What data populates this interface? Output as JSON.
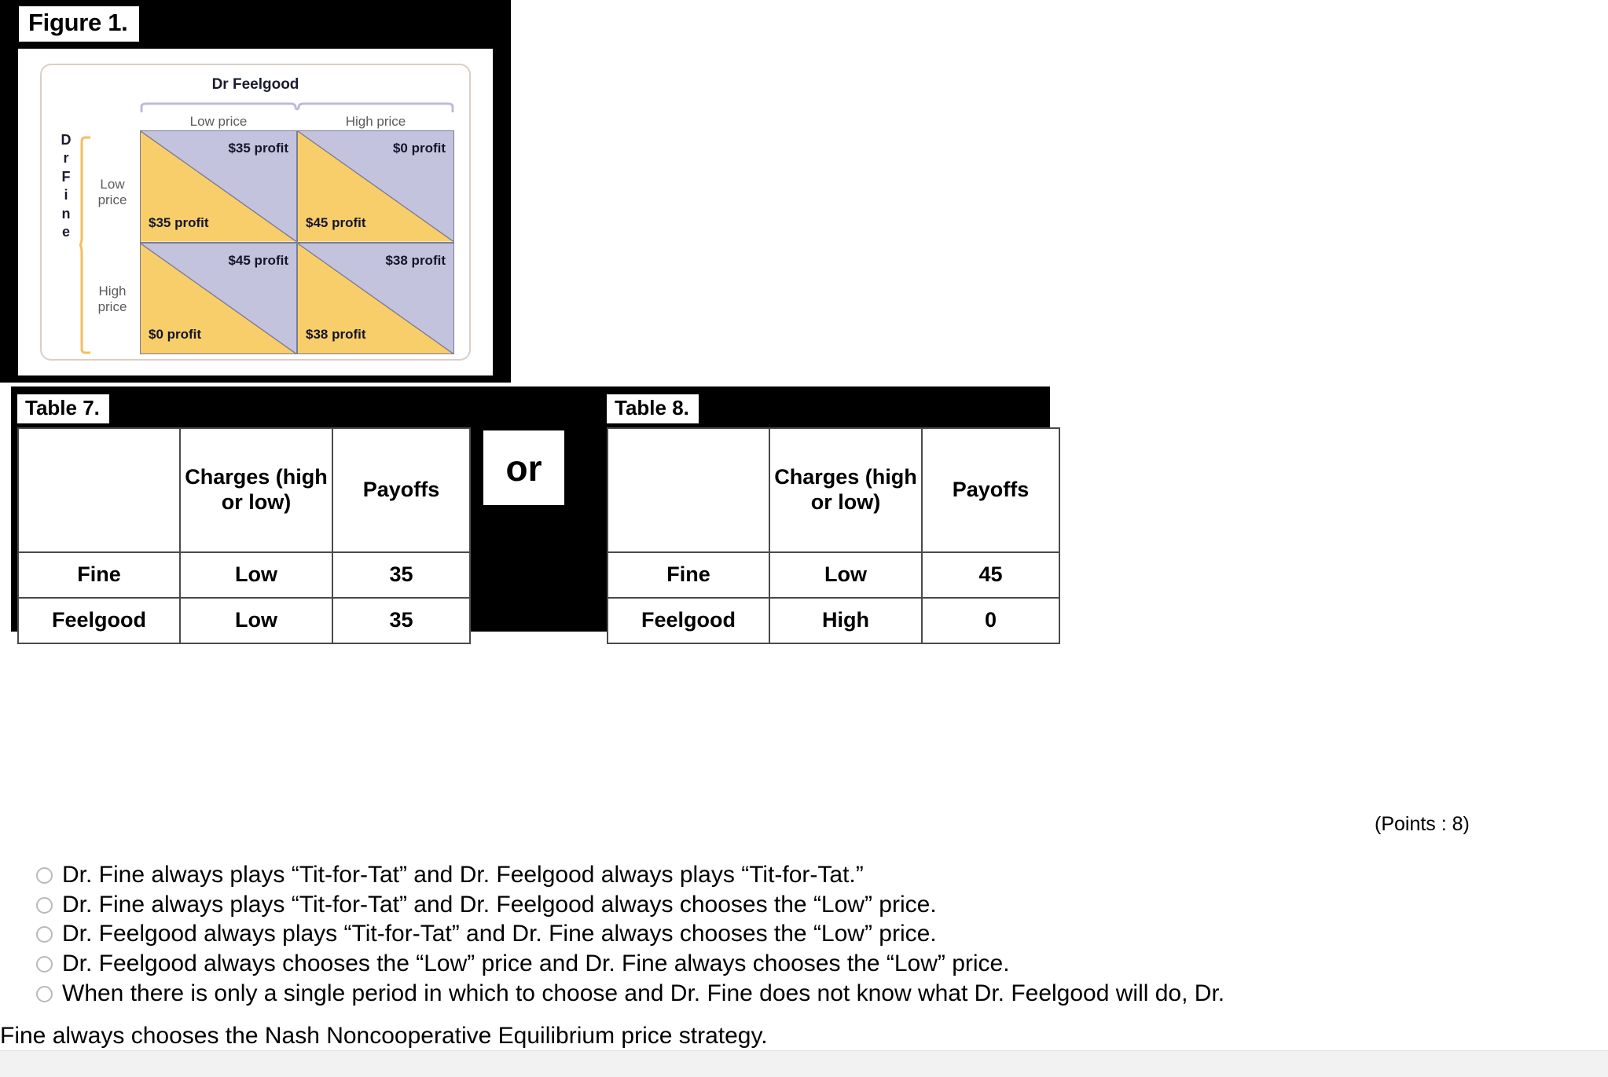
{
  "figure": {
    "title": "Figure 1.",
    "column_player": "Dr Feelgood",
    "column_labels": [
      "Low price",
      "High price"
    ],
    "row_player_letters": [
      "D",
      "r",
      "F",
      "i",
      "n",
      "e"
    ],
    "row_labels": [
      "Low\nprice",
      "High\nprice"
    ],
    "row_label_low_line1": "Low",
    "row_label_low_line2": "price",
    "row_label_high_line1": "High",
    "row_label_high_line2": "price",
    "colors": {
      "column_player_fill": "#C4C3DE",
      "row_player_fill": "#F8CE6B",
      "cell_border": "#7C7C93",
      "card_border": "#D9CFC6",
      "brace_col": "#BDBBDC",
      "brace_row": "#F5BE5E"
    },
    "cells": [
      {
        "row": "Low price",
        "col": "Low price",
        "column_payoff": "$35 profit",
        "row_payoff": "$35 profit"
      },
      {
        "row": "Low price",
        "col": "High price",
        "column_payoff": "$0 profit",
        "row_payoff": "$45 profit"
      },
      {
        "row": "High price",
        "col": "Low price",
        "column_payoff": "$45 profit",
        "row_payoff": "$0 profit"
      },
      {
        "row": "High price",
        "col": "High price",
        "column_payoff": "$38 profit",
        "row_payoff": "$38 profit"
      }
    ]
  },
  "tables": {
    "or_label": "or",
    "table7": {
      "title": "Table 7.",
      "headers": [
        "",
        "Charges (high or low)",
        "Payoffs"
      ],
      "header_blank": "",
      "header_charges": "Charges (high or low)",
      "header_payoffs": "Payoffs",
      "rows": [
        {
          "player": "Fine",
          "charges": "Low",
          "payoff": "35"
        },
        {
          "player": "Feelgood",
          "charges": "Low",
          "payoff": "35"
        }
      ]
    },
    "table8": {
      "title": "Table 8.",
      "headers": [
        "",
        "Charges (high or low)",
        "Payoffs"
      ],
      "header_blank": "",
      "header_charges": "Charges (high or low)",
      "header_payoffs": "Payoffs",
      "rows": [
        {
          "player": "Fine",
          "charges": "Low",
          "payoff": "45"
        },
        {
          "player": "Feelgood",
          "charges": "High",
          "payoff": "0"
        }
      ]
    }
  },
  "points_label": "(Points : 8)",
  "options": [
    {
      "text": "Dr. Fine always plays “Tit-for-Tat” and Dr. Feelgood always plays “Tit-for-Tat.”"
    },
    {
      "text": "Dr. Fine always plays “Tit-for-Tat” and Dr. Feelgood always chooses the “Low” price."
    },
    {
      "text": "Dr. Feelgood always plays “Tit-for-Tat” and Dr. Fine always chooses the “Low” price."
    },
    {
      "text": "Dr. Feelgood always chooses the “Low” price and Dr. Fine always chooses the “Low” price."
    },
    {
      "text": "When there is only a single period in which to choose and Dr. Fine does not know what Dr. Feelgood will do, Dr."
    }
  ],
  "option_last_wrap": "Fine always chooses the Nash Noncooperative Equilibrium price strategy."
}
